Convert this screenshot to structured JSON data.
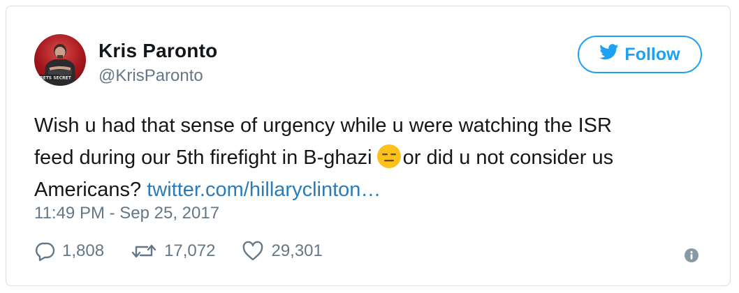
{
  "author": {
    "name": "Kris Paronto",
    "handle": "@KrisParonto",
    "avatar_text": "RETS SECRET"
  },
  "follow_button": {
    "label": "Follow",
    "icon": "twitter-bird-icon"
  },
  "tweet": {
    "line1": "Wish u had that sense of urgency while u were watching the ISR",
    "line2_before_emoji": "feed during our 5th firefight in B-ghazi",
    "emoji": "expressionless-face-emoji",
    "line2_after_emoji": "or did u not consider us",
    "line3_text": "Americans?",
    "link_text": "twitter.com/hillaryclinton…"
  },
  "timestamp": "11:49 PM - Sep 25, 2017",
  "actions": {
    "replies": "1,808",
    "retweets": "17,072",
    "likes": "29,301"
  },
  "colors": {
    "accent": "#1da1f2",
    "link": "#2b7bb9",
    "muted": "#657786",
    "text": "#14171a",
    "border": "#d8dee3"
  }
}
